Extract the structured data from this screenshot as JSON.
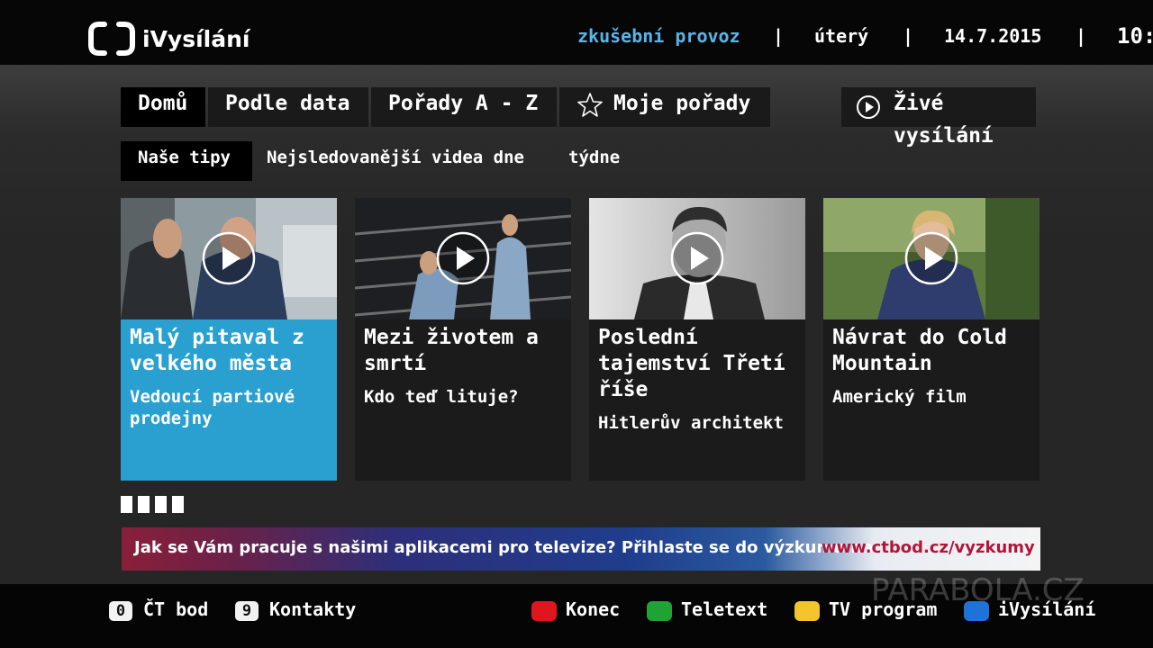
{
  "header": {
    "logo_text": "iVysílání",
    "mode": "zkušební provoz",
    "separator": "|",
    "day": "úterý",
    "date": "14.7.2015",
    "time": "10:"
  },
  "tabs": [
    {
      "label": "Domů",
      "active": true
    },
    {
      "label": "Podle data"
    },
    {
      "label": "Pořady A - Z"
    },
    {
      "label": "Moje pořady",
      "icon": "star-icon"
    },
    {
      "label": "Živé vysílání",
      "icon": "play-icon"
    }
  ],
  "subtabs": [
    {
      "label": "Naše tipy",
      "active": true
    },
    {
      "label": "Nejsledovanější videa dne"
    },
    {
      "label": "týdne"
    }
  ],
  "cards": [
    {
      "title": "Malý pitaval z velkého města",
      "subtitle": "Vedoucí partiové prodejny",
      "selected": true
    },
    {
      "title": "Mezi životem a smrtí",
      "subtitle": "Kdo teď lituje?"
    },
    {
      "title": "Poslední tajemství Třetí říše",
      "subtitle": "Hitlerův architekt"
    },
    {
      "title": "Návrat do Cold Mountain",
      "subtitle": "Americký film"
    }
  ],
  "pager_count": 4,
  "banner": {
    "text": "Jak se Vám pracuje s našimi aplikacemi pro televize? Přihlaste se do výzkumu na",
    "link": "www.ctbod.cz/vyzkumy"
  },
  "footer": {
    "keys": [
      {
        "key": "0",
        "label": "ČT bod"
      },
      {
        "key": "9",
        "label": "Kontakty"
      }
    ],
    "color_keys": [
      {
        "color": "#e0161e",
        "label": "Konec"
      },
      {
        "color": "#1fa334",
        "label": "Teletext"
      },
      {
        "color": "#f2c52e",
        "label": "TV program"
      },
      {
        "color": "#1f72d8",
        "label": "iVysílání"
      }
    ]
  },
  "watermark": "PARABOLA.CZ",
  "colors": {
    "accent": "#2aa0d0",
    "mode_text": "#5ab4e8",
    "banner_link": "#b0163a"
  }
}
